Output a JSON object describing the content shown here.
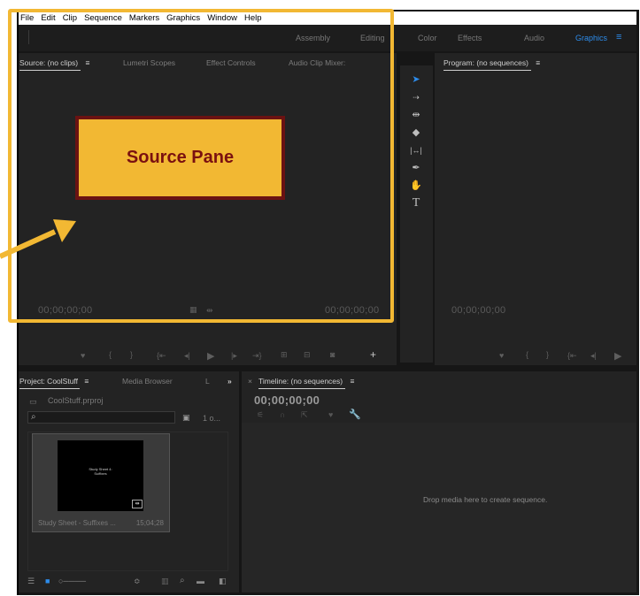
{
  "menu": {
    "items": [
      "File",
      "Edit",
      "Clip",
      "Sequence",
      "Markers",
      "Graphics",
      "Window",
      "Help"
    ]
  },
  "workspaces": {
    "items": [
      "Assembly",
      "Editing",
      "Color",
      "Effects",
      "Audio",
      "Graphics"
    ],
    "active": "Graphics",
    "menu_icon": "≡"
  },
  "source_panel": {
    "tabs": [
      "Source: (no clips)",
      "Lumetri Scopes",
      "Effect Controls",
      "Audio Clip Mixer:"
    ],
    "tab_menu": "≡",
    "timecode_left": "00;00;00;00",
    "timecode_right": "00;00;00;00"
  },
  "program_panel": {
    "title": "Program: (no sequences)",
    "tab_menu": "≡",
    "timecode": "00;00;00;00"
  },
  "project_panel": {
    "title": "Project: CoolStuff",
    "tab_menu": "≡",
    "tabs": [
      "Media Browser",
      "L"
    ],
    "overflow": "»",
    "file": "CoolStuff.prproj",
    "search_placeholder": "",
    "count": "1 o...",
    "clip": {
      "name": "Study Sheet - Suffixes ...",
      "duration": "15;04;28",
      "preview_line1": "Study Sheet 4:",
      "preview_line2": "Suffixes"
    }
  },
  "timeline_panel": {
    "close": "×",
    "title": "Timeline: (no sequences)",
    "tab_menu": "≡",
    "timecode": "00;00;00;00",
    "empty_hint": "Drop media here to create sequence."
  },
  "annotation": {
    "label": "Source Pane",
    "color": "#f2b833",
    "text_color": "#7a1010"
  },
  "colors": {
    "accent": "#2d8ceb",
    "panel": "#232323",
    "background": "#161616"
  }
}
